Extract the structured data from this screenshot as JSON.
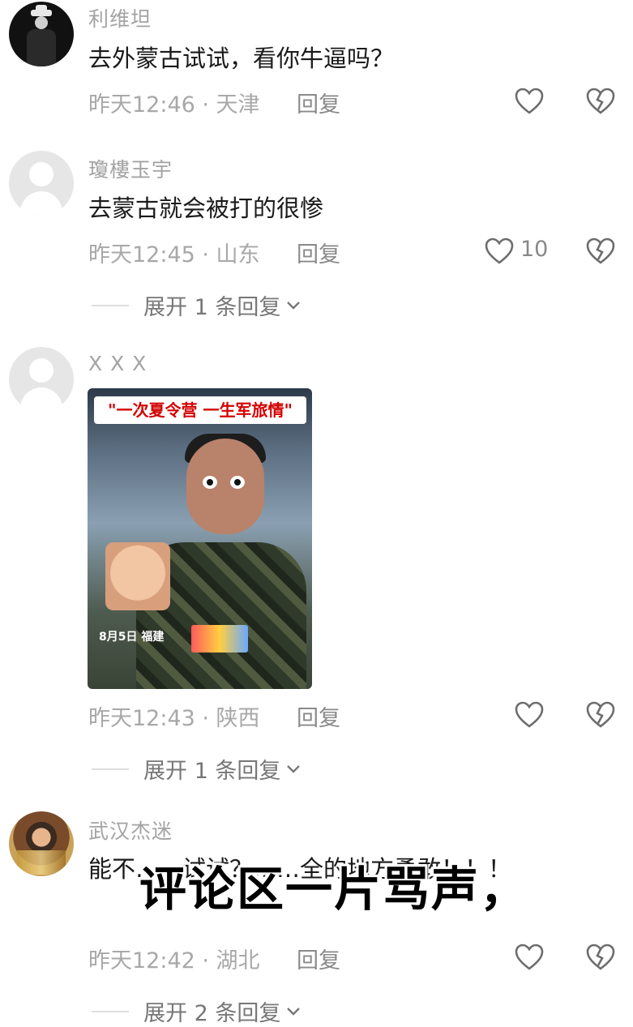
{
  "comments": [
    {
      "username": "利维坦",
      "text": "去外蒙古试试，看你牛逼吗？",
      "meta": "昨天12:46 · 天津",
      "reply_label": "回复",
      "likes": "",
      "avatar_icon": "dark-portrait"
    },
    {
      "username": "瓊樓玉宇",
      "text": "去蒙古就会被打的很惨",
      "meta": "昨天12:45 · 山东",
      "reply_label": "回复",
      "likes": "10",
      "expand_label": "展开 1 条回复",
      "avatar_icon": "default-user"
    },
    {
      "username": "X X X",
      "media": {
        "banner": "\"一次夏令营 一生军旅情\"",
        "caption": "8月5日 福建"
      },
      "meta": "昨天12:43 · 陕西",
      "reply_label": "回复",
      "likes": "",
      "expand_label": "展开 1 条回复",
      "avatar_icon": "default-user"
    },
    {
      "username": "武汉杰迷",
      "text": "能不……试试？……全的地方勇敢！！！",
      "meta": "昨天12:42 · 湖北",
      "reply_label": "回复",
      "likes": "",
      "expand_label": "展开 2 条回复",
      "avatar_icon": "photo-portrait"
    }
  ],
  "overlay_caption": "评论区一片骂声，"
}
